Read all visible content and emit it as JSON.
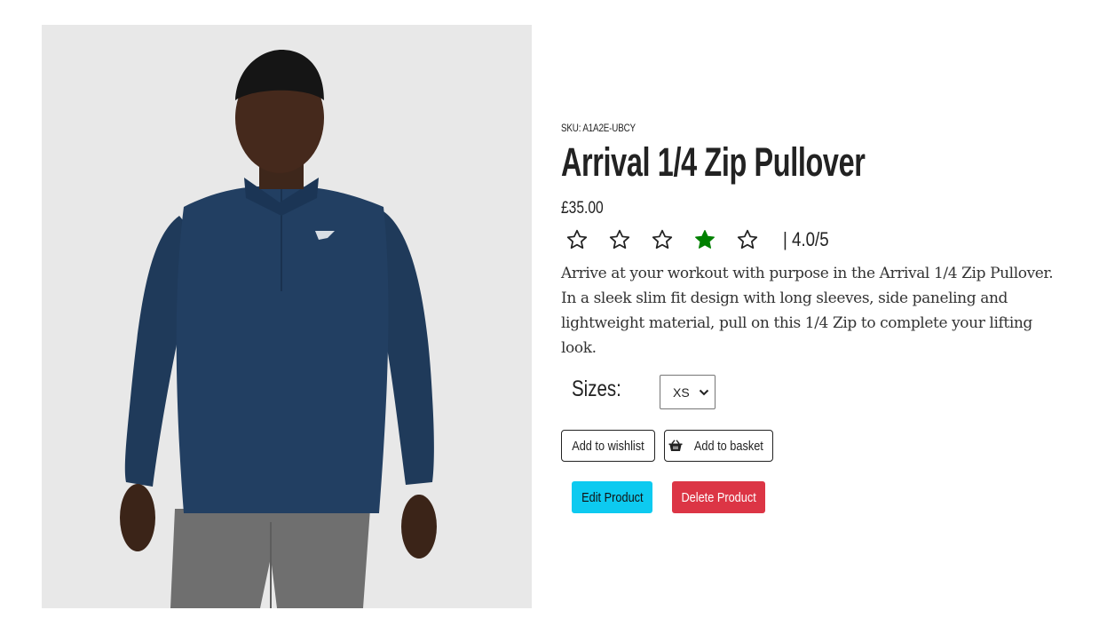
{
  "product": {
    "image_icon": "product-photo",
    "sku_text": "SKU: A1A2E-UBCY",
    "title": "Arrival 1/4 Zip Pullover",
    "price": "£35.00",
    "rating": {
      "value": 4.0,
      "max": 5,
      "text": "| 4.0/5",
      "highlighted_star_index": 3,
      "highlight_color": "#008000",
      "outline_color": "#222222"
    },
    "description": "Arrive at your workout with purpose in the Arrival 1/4 Zip Pullover. In a sleek slim fit design with long sleeves, side paneling and lightweight material, pull on this 1/4 Zip to complete your lifting look."
  },
  "sizes": {
    "label": "Sizes:",
    "selected": "XS"
  },
  "actions": {
    "wishlist_label": "Add to wishlist",
    "basket_label": "Add to basket",
    "basket_icon": "basket-icon",
    "edit_label": "Edit Product",
    "delete_label": "Delete Product",
    "edit_color": "#0dcaf0",
    "delete_color": "#dc3545"
  }
}
